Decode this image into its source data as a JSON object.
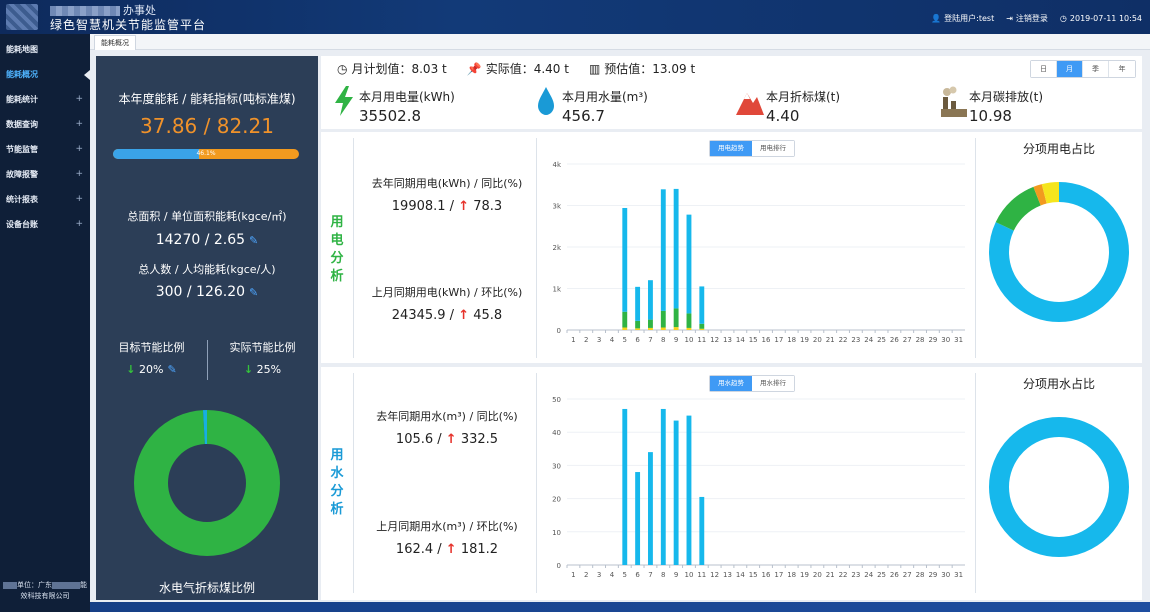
{
  "header": {
    "org_name_suffix": "办事处",
    "platform_title": "绿色智慧机关节能监管平台",
    "user_label": "登陆用户:test",
    "logout_label": "注销登录",
    "datetime": "2019-07-11 10:54"
  },
  "sidebar": {
    "items": [
      {
        "label": "能耗地图",
        "expandable": false
      },
      {
        "label": "能耗概况",
        "expandable": false,
        "active": true
      },
      {
        "label": "能耗统计",
        "expandable": true
      },
      {
        "label": "数据查询",
        "expandable": true
      },
      {
        "label": "节能监管",
        "expandable": true
      },
      {
        "label": "故障报警",
        "expandable": true
      },
      {
        "label": "统计报表",
        "expandable": true
      },
      {
        "label": "设备台账",
        "expandable": true
      }
    ],
    "footer_line1_prefix": "单位：广东",
    "footer_line1_suffix": "能",
    "footer_line2": "效科技有限公司"
  },
  "tabs": {
    "active": "能耗概况"
  },
  "left_panel": {
    "annual_label": "本年度能耗 / 能耗指标(吨标准煤)",
    "annual_value": "37.86 / 82.21",
    "annual_progress_pct": 46.1,
    "annual_progress_text": "46.1%",
    "area_label": "总面积 / 单位面积能耗(kgce/㎡)",
    "area_value": "14270 / 2.65",
    "people_label": "总人数 / 人均能耗(kgce/人)",
    "people_value": "300 / 126.20",
    "target_label": "目标节能比例",
    "target_value": "20%",
    "actual_label": "实际节能比例",
    "actual_value": "25%",
    "caption": "水电气折标煤比例",
    "donut_colors": {
      "main": "#2fb344",
      "minor": "#16b0e0"
    },
    "donut_shares": [
      0.99,
      0.01
    ]
  },
  "stats": {
    "plan": "月计划值：8.03 t",
    "actual": "实际值：4.40 t",
    "estimate": "预估值：13.09 t",
    "periods": [
      "日",
      "月",
      "季",
      "年"
    ],
    "active_period": "月",
    "kpis": [
      {
        "label": "本月用电量(kWh)",
        "value": "35502.8",
        "icon": "lightning-icon"
      },
      {
        "label": "本月用水量(m³)",
        "value": "456.7",
        "icon": "water-drop-icon"
      },
      {
        "label": "本月折标煤(t)",
        "value": "4.40",
        "icon": "mountain-icon"
      },
      {
        "label": "本月碳排放(t)",
        "value": "10.98",
        "icon": "factory-icon"
      }
    ]
  },
  "electric": {
    "side_label": [
      "用",
      "电",
      "分",
      "析"
    ],
    "side_color": "#2fb344",
    "last_year_label": "去年同期用电(kWh) / 同比(%)",
    "last_year_value": "19908.1 /",
    "last_year_ratio": "78.3",
    "last_month_label": "上月同期用电(kWh) / 环比(%)",
    "last_month_value": "24345.9 /",
    "last_month_ratio": "45.8",
    "toggle": [
      "用电趋势",
      "用电排行"
    ],
    "pie_title": "分项用电占比"
  },
  "water": {
    "side_label": [
      "用",
      "水",
      "分",
      "析"
    ],
    "side_color": "#1a9ad6",
    "last_year_label": "去年同期用水(m³) / 同比(%)",
    "last_year_value": "105.6 /",
    "last_year_ratio": "332.5",
    "last_month_label": "上月同期用水(m³) / 环比(%)",
    "last_month_value": "162.4 /",
    "last_month_ratio": "181.2",
    "toggle": [
      "用水趋势",
      "用水排行"
    ],
    "pie_title": "分项用水占比"
  },
  "chart_data": [
    {
      "type": "bar",
      "stacked": true,
      "categories": [
        "1",
        "2",
        "3",
        "4",
        "5",
        "6",
        "7",
        "8",
        "9",
        "10",
        "11",
        "12",
        "13",
        "14",
        "15",
        "16",
        "17",
        "18",
        "19",
        "20",
        "21",
        "22",
        "23",
        "24",
        "25",
        "26",
        "27",
        "28",
        "29",
        "30",
        "31"
      ],
      "y_ticks": [
        "0",
        "1k",
        "2k",
        "3k",
        "4k"
      ],
      "ylim": [
        0,
        4000
      ],
      "series": [
        {
          "color": "#f5d31e",
          "values": [
            0,
            0,
            0,
            0,
            60,
            40,
            50,
            60,
            70,
            50,
            30,
            0,
            0,
            0,
            0,
            0,
            0,
            0,
            0,
            0,
            0,
            0,
            0,
            0,
            0,
            0,
            0,
            0,
            0,
            0,
            0
          ]
        },
        {
          "color": "#2fb344",
          "values": [
            0,
            0,
            0,
            0,
            380,
            180,
            200,
            400,
            450,
            350,
            120,
            0,
            0,
            0,
            0,
            0,
            0,
            0,
            0,
            0,
            0,
            0,
            0,
            0,
            0,
            0,
            0,
            0,
            0,
            0,
            0
          ]
        },
        {
          "color": "#16b8ec",
          "values": [
            0,
            0,
            0,
            0,
            2500,
            820,
            950,
            2930,
            2880,
            2380,
            900,
            0,
            0,
            0,
            0,
            0,
            0,
            0,
            0,
            0,
            0,
            0,
            0,
            0,
            0,
            0,
            0,
            0,
            0,
            0,
            0
          ]
        }
      ]
    },
    {
      "type": "bar",
      "categories": [
        "1",
        "2",
        "3",
        "4",
        "5",
        "6",
        "7",
        "8",
        "9",
        "10",
        "11",
        "12",
        "13",
        "14",
        "15",
        "16",
        "17",
        "18",
        "19",
        "20",
        "21",
        "22",
        "23",
        "24",
        "25",
        "26",
        "27",
        "28",
        "29",
        "30",
        "31"
      ],
      "y_ticks": [
        "0",
        "10",
        "20",
        "30",
        "40",
        "50"
      ],
      "ylim": [
        0,
        50
      ],
      "series": [
        {
          "color": "#16b8ec",
          "values": [
            0,
            0,
            0,
            0,
            47,
            28,
            34,
            47,
            43.5,
            45,
            20.5,
            0,
            0,
            0,
            0,
            0,
            0,
            0,
            0,
            0,
            0,
            0,
            0,
            0,
            0,
            0,
            0,
            0,
            0,
            0,
            0
          ]
        }
      ]
    },
    {
      "type": "pie",
      "donut": true,
      "slices": [
        {
          "color": "#16b8ec",
          "value": 82
        },
        {
          "color": "#2fb344",
          "value": 12
        },
        {
          "color": "#f29a1f",
          "value": 2
        },
        {
          "color": "#f5e51e",
          "value": 4
        }
      ]
    },
    {
      "type": "pie",
      "donut": true,
      "slices": [
        {
          "color": "#16b8ec",
          "value": 100
        }
      ]
    }
  ]
}
